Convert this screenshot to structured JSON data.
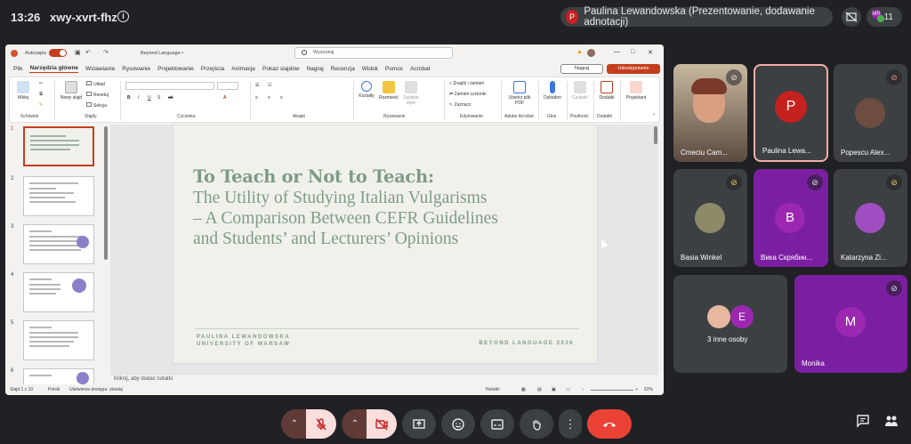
{
  "topbar": {
    "time": "13:26",
    "meeting_code": "xwy-xvrt-fhz",
    "presenter_initial": "P",
    "presenter_text": "Paulina Lewandowska (Prezentowanie, dodawanie adnotacji)",
    "participant_count": "11",
    "participant_badge": "MR"
  },
  "ppt": {
    "autosave_label": "Autozapis",
    "file_name": "Beyond Language •",
    "search_placeholder": "Wyszukaj",
    "menu": [
      "Plik",
      "Narzędzia główne",
      "Wstawianie",
      "Rysowanie",
      "Projektowanie",
      "Przejścia",
      "Animacje",
      "Pokaz slajdów",
      "Nagraj",
      "Recenzja",
      "Widok",
      "Pomoc",
      "Acrobat"
    ],
    "record_btn": "Nagraj",
    "share_btn": "Udostępnianie",
    "ribbon": {
      "paste": "Wklej",
      "clipboard": "Schowek",
      "new_slide": "Nowy slajd",
      "layout": "Układ",
      "reset": "Resetuj",
      "section": "Sekcja",
      "slides_group": "Slajdy",
      "font_group": "Czcionka",
      "paragraph_group": "Akapit",
      "shapes": "Kształty",
      "arrange": "Rozmieść",
      "quick_styles": "Szybkie style",
      "drawing_group": "Rysowanie",
      "find_replace": "Znajdź i zamień",
      "replace_fonts": "Zamień czcionki",
      "select": "Zaznacz",
      "editing_group": "Edytowanie",
      "create_pdf": "Utwórz plik PDF",
      "acrobat_group": "Adobe Acrobat",
      "dictate": "Dyktafon",
      "voice_group": "Głos",
      "sensitivity": "Czułość",
      "privacy_group": "Poufność",
      "addins": "Dodatki",
      "addins_group": "Dodatki",
      "designer": "Projektant"
    },
    "slide_numbers": [
      "1",
      "2",
      "3",
      "4",
      "5",
      "6"
    ],
    "slide": {
      "title_line1": "To Teach or Not to Teach:",
      "title_line2": "The Utility of Studying Italian Vulgarisms",
      "title_line3": "– A Comparison Between CEFR Guidelines",
      "title_line4": "and Students’ and Lecturers’ Opinions",
      "author_name": "PAULINA LEWANDOWSKA",
      "author_affil": "UNIVERSITY OF WARSAW",
      "conference": "BEYOND LANGUAGE 2026"
    },
    "notes_placeholder": "Kliknij, aby dodać notatki",
    "status": {
      "slide_counter": "Slajd 1 z 10",
      "language": "Polski",
      "accessibility": "Ułatwienia dostępu: zbadaj",
      "notes": "Notatki",
      "zoom": "52%"
    }
  },
  "participants": [
    {
      "name": "Cmeciu Cam...",
      "initial": ""
    },
    {
      "name": "Paulina Lewa...",
      "initial": "P"
    },
    {
      "name": "Popescu Alex...",
      "initial": ""
    },
    {
      "name": "Basia Winkel",
      "initial": ""
    },
    {
      "name": "Вика Скрябин...",
      "initial": "B"
    },
    {
      "name": "Katarzyna Zi...",
      "initial": ""
    },
    {
      "name": "3 inne osoby",
      "initial": "E"
    },
    {
      "name": "Monika",
      "initial": "M"
    }
  ],
  "colors": {
    "meet_bg": "#202124",
    "tile_bg": "#3c4043",
    "accent_red": "#ea4335",
    "ppt_accent": "#c43e1c",
    "slide_title": "#7e9c85"
  }
}
